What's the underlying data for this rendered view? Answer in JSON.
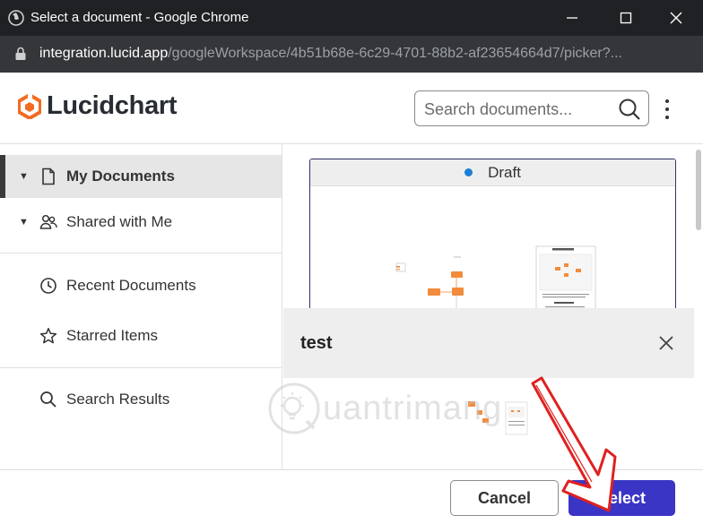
{
  "window": {
    "title": "Select a document - Google Chrome",
    "minimize_glyph": "—",
    "maximize_glyph": "☐",
    "close_glyph": "✕"
  },
  "address": {
    "host": "integration.lucid.app",
    "path": "/googleWorkspace/4b51b68e-6c29-4701-88b2-af23654664d7/picker?..."
  },
  "header": {
    "brand": "Lucidchart",
    "brand_color": "#f26c21",
    "search_placeholder": "Search documents..."
  },
  "sidebar": {
    "items": [
      {
        "label": "My Documents",
        "icon": "document-icon",
        "active": true
      },
      {
        "label": "Shared with Me",
        "icon": "people-icon",
        "active": false
      },
      {
        "label": "Recent Documents",
        "icon": "clock-icon",
        "active": false
      },
      {
        "label": "Starred Items",
        "icon": "star-icon",
        "active": false
      },
      {
        "label": "Search Results",
        "icon": "magnifier-icon",
        "active": false
      }
    ]
  },
  "content": {
    "card_status": "Draft",
    "status_color": "#1a7fd4",
    "panel_title": "test"
  },
  "watermark": {
    "text": "uantrimang"
  },
  "footer": {
    "cancel_label": "Cancel",
    "select_label": "Select",
    "select_color": "#3b35c5"
  }
}
